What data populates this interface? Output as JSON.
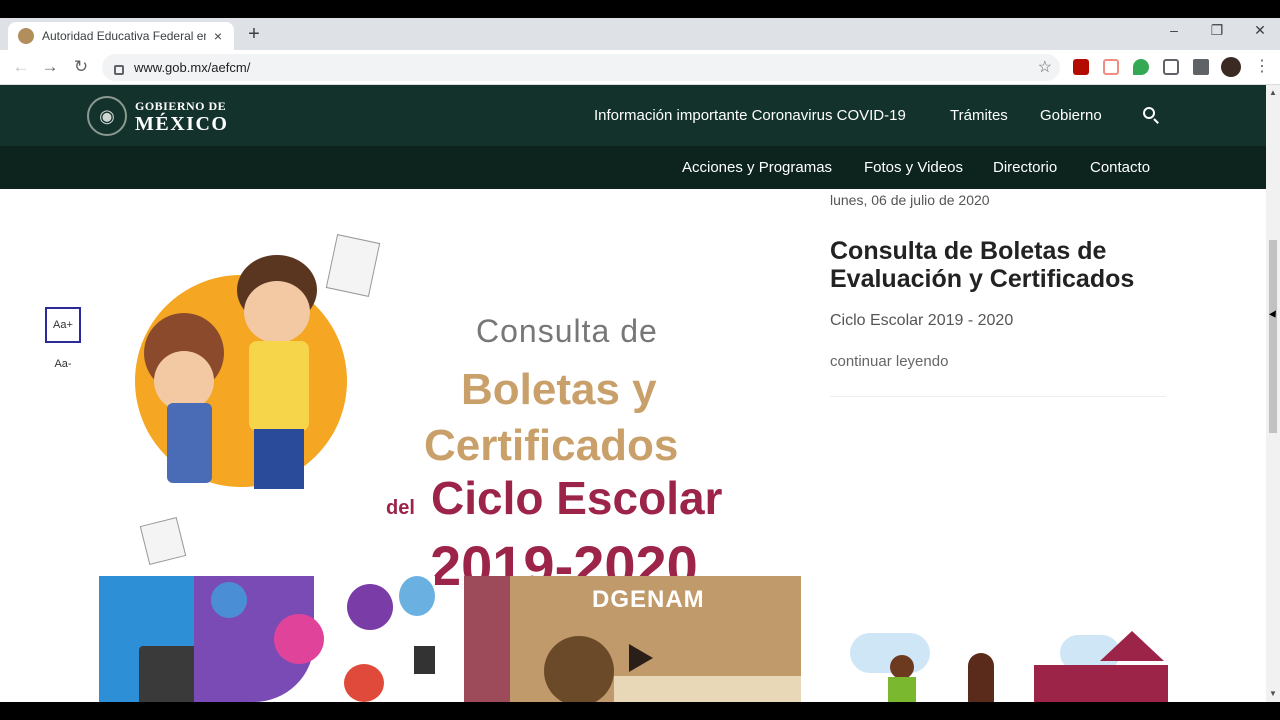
{
  "browser": {
    "tab_title": "Autoridad Educativa Federal en la",
    "tab_close": "×",
    "new_tab": "+",
    "url": "www.gob.mx/aefcm/",
    "minimize": "–",
    "restore": "❐",
    "close": "✕",
    "back": "←",
    "forward": "→",
    "reload": "↻",
    "bookmark": "☆",
    "menu": "⋮"
  },
  "header": {
    "logo_line1": "GOBIERNO DE",
    "logo_line2": "MÉXICO",
    "top_links": [
      "Información importante Coronavirus COVID-19",
      "Trámites",
      "Gobierno"
    ],
    "sub_links": [
      "Acciones y Programas",
      "Fotos y Videos",
      "Directorio",
      "Contacto"
    ]
  },
  "accessibility": {
    "increase": "Aa+",
    "decrease": "Aa-"
  },
  "banner": {
    "line1": "Consulta de",
    "line2": "Boletas y",
    "line3": "Certificados",
    "del": "del",
    "line4": "Ciclo Escolar",
    "line5": "2019-2020"
  },
  "article": {
    "date": "lunes, 06 de julio de 2020",
    "title": "Consulta de Boletas de Evaluación y Certificados",
    "subtitle": "Ciclo Escolar 2019 - 2020",
    "read_more": "continuar leyendo"
  },
  "cards": {
    "card2_label": "DGENAM"
  },
  "colors": {
    "gob_green": "#13322b",
    "gob_dark": "#0c231e",
    "guinda": "#9d2449",
    "dorado": "#c9a06a",
    "orange": "#f5a623"
  }
}
